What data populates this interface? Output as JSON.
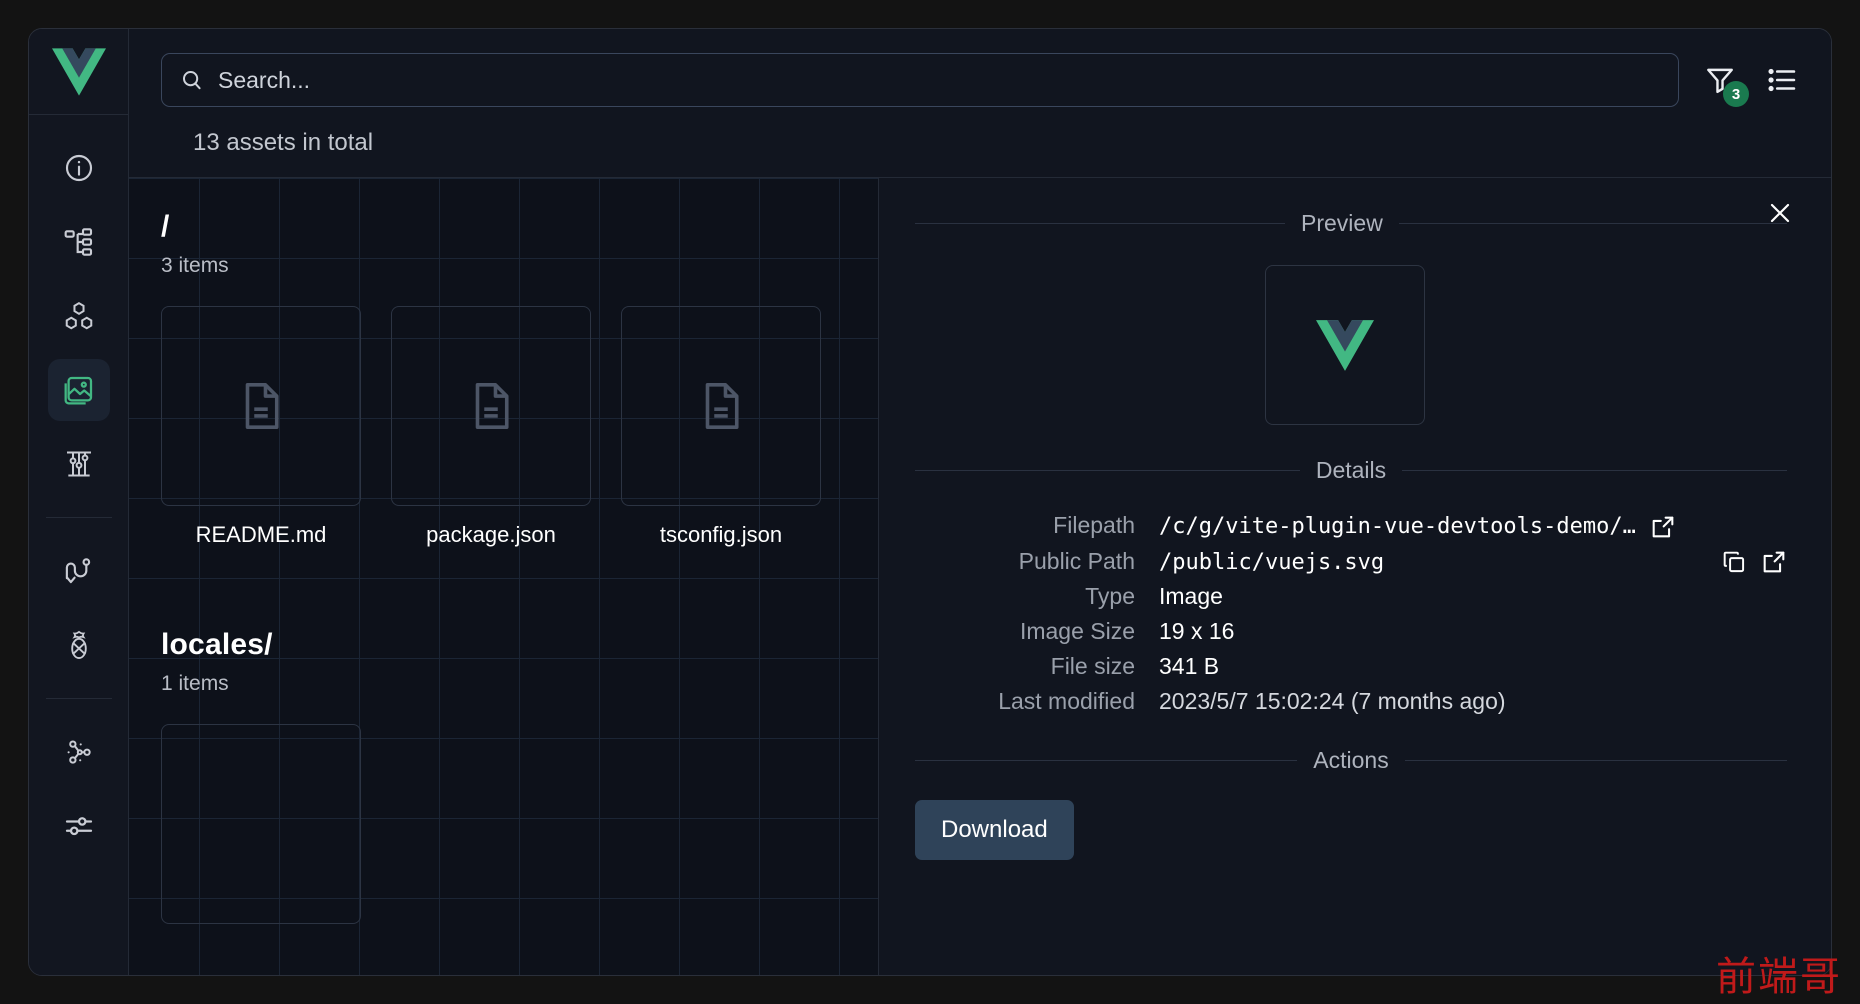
{
  "colors": {
    "accent_green": "#42b883",
    "badge_green": "#1a7a4f",
    "button_blue": "#2f4359",
    "panel_bg": "#11151f",
    "browser_bg": "#0d111a",
    "grid_line": "#1b2535",
    "watermark_red": "#c01a1a"
  },
  "sidebar": {
    "logo": "vue-logo",
    "items": [
      {
        "name": "overview",
        "icon": "info-circle-icon",
        "active": false
      },
      {
        "name": "components",
        "icon": "component-tree-icon",
        "active": false
      },
      {
        "name": "pages",
        "icon": "hexagons-icon",
        "active": false
      },
      {
        "name": "assets",
        "icon": "image-icon",
        "active": true
      },
      {
        "name": "timeline",
        "icon": "timeline-icon",
        "active": false
      },
      {
        "name": "routes",
        "icon": "route-icon",
        "active": false
      },
      {
        "name": "pinia",
        "icon": "pineapple-icon",
        "active": false
      },
      {
        "name": "graph",
        "icon": "graph-icon",
        "active": false
      },
      {
        "name": "settings",
        "icon": "sliders-icon",
        "active": false
      }
    ]
  },
  "search": {
    "value": "",
    "placeholder": "Search...",
    "icon": "search-icon"
  },
  "toolbar": {
    "filter_icon": "filter-icon",
    "filter_badge": "3",
    "list_icon": "list-icon"
  },
  "summary": {
    "assets_total": "13 assets in total"
  },
  "browser": {
    "groups": [
      {
        "title": "/",
        "count": "3 items",
        "tiles": [
          {
            "name": "README.md",
            "icon": "file-icon"
          },
          {
            "name": "package.json",
            "icon": "file-icon"
          },
          {
            "name": "tsconfig.json",
            "icon": "file-icon"
          }
        ]
      },
      {
        "title": "locales/",
        "count": "1 items",
        "tiles": [
          {
            "name": "",
            "icon": "file-icon"
          }
        ]
      }
    ]
  },
  "details": {
    "close_icon": "close-icon",
    "preview_label": "Preview",
    "preview_image": "vue-logo",
    "details_label": "Details",
    "rows": [
      {
        "label": "Filepath",
        "value": "/c/g/vite-plugin-vue-devtools-demo/…",
        "mono": true,
        "actions": [
          "external-link-icon"
        ]
      },
      {
        "label": "Public Path",
        "value": "/public/vuejs.svg",
        "mono": true,
        "actions": [
          "copy-icon",
          "external-link-icon"
        ]
      },
      {
        "label": "Type",
        "value": "Image",
        "mono": false,
        "actions": []
      },
      {
        "label": "Image Size",
        "value": "19 x 16",
        "mono": false,
        "actions": []
      },
      {
        "label": "File size",
        "value": "341 B",
        "mono": false,
        "actions": []
      },
      {
        "label": "Last modified",
        "value": "2023/5/7 15:02:24 (7 months ago)",
        "mono": false,
        "actions": []
      }
    ],
    "actions_label": "Actions",
    "download_label": "Download"
  },
  "watermark": {
    "text": "前端哥"
  }
}
